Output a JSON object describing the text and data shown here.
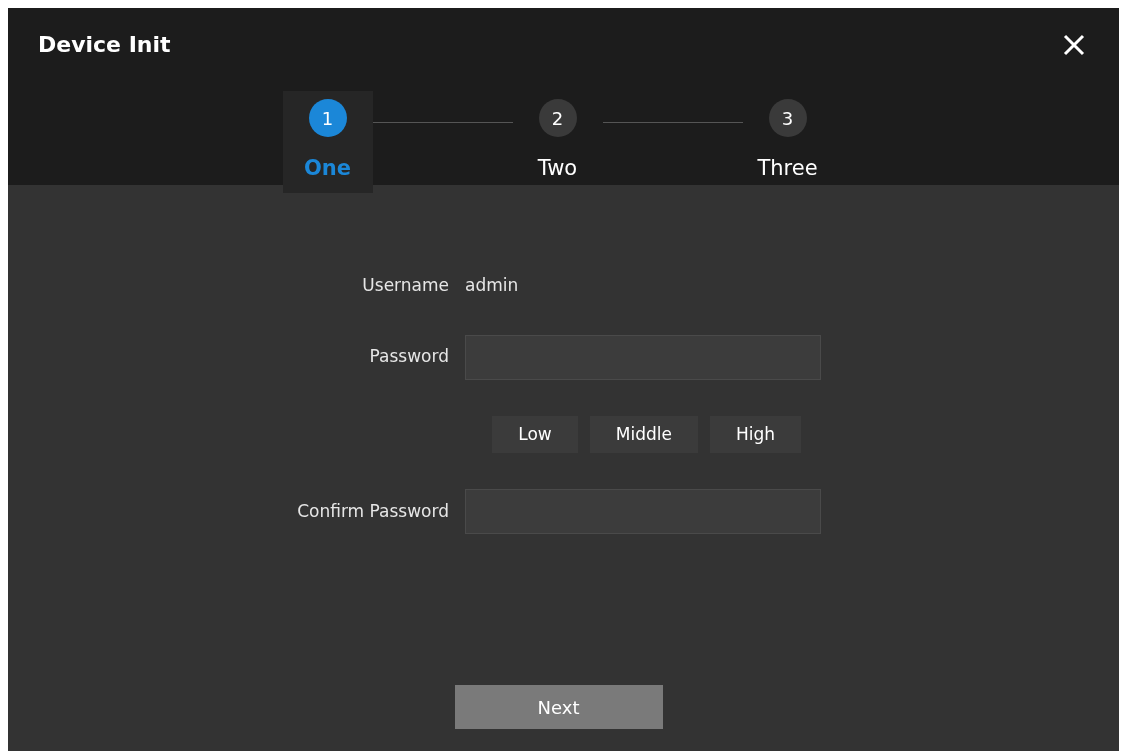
{
  "window": {
    "title": "Device Init"
  },
  "steps": [
    {
      "number": "1",
      "label": "One",
      "selected": true
    },
    {
      "number": "2",
      "label": "Two",
      "selected": false
    },
    {
      "number": "3",
      "label": "Three",
      "selected": false
    }
  ],
  "form": {
    "username": {
      "label": "Username",
      "value": "admin"
    },
    "password": {
      "label": "Password"
    },
    "strength": [
      "Low",
      "Middle",
      "High"
    ],
    "confirm": {
      "label": "Confirm Password"
    }
  },
  "buttons": [
    "Next"
  ]
}
